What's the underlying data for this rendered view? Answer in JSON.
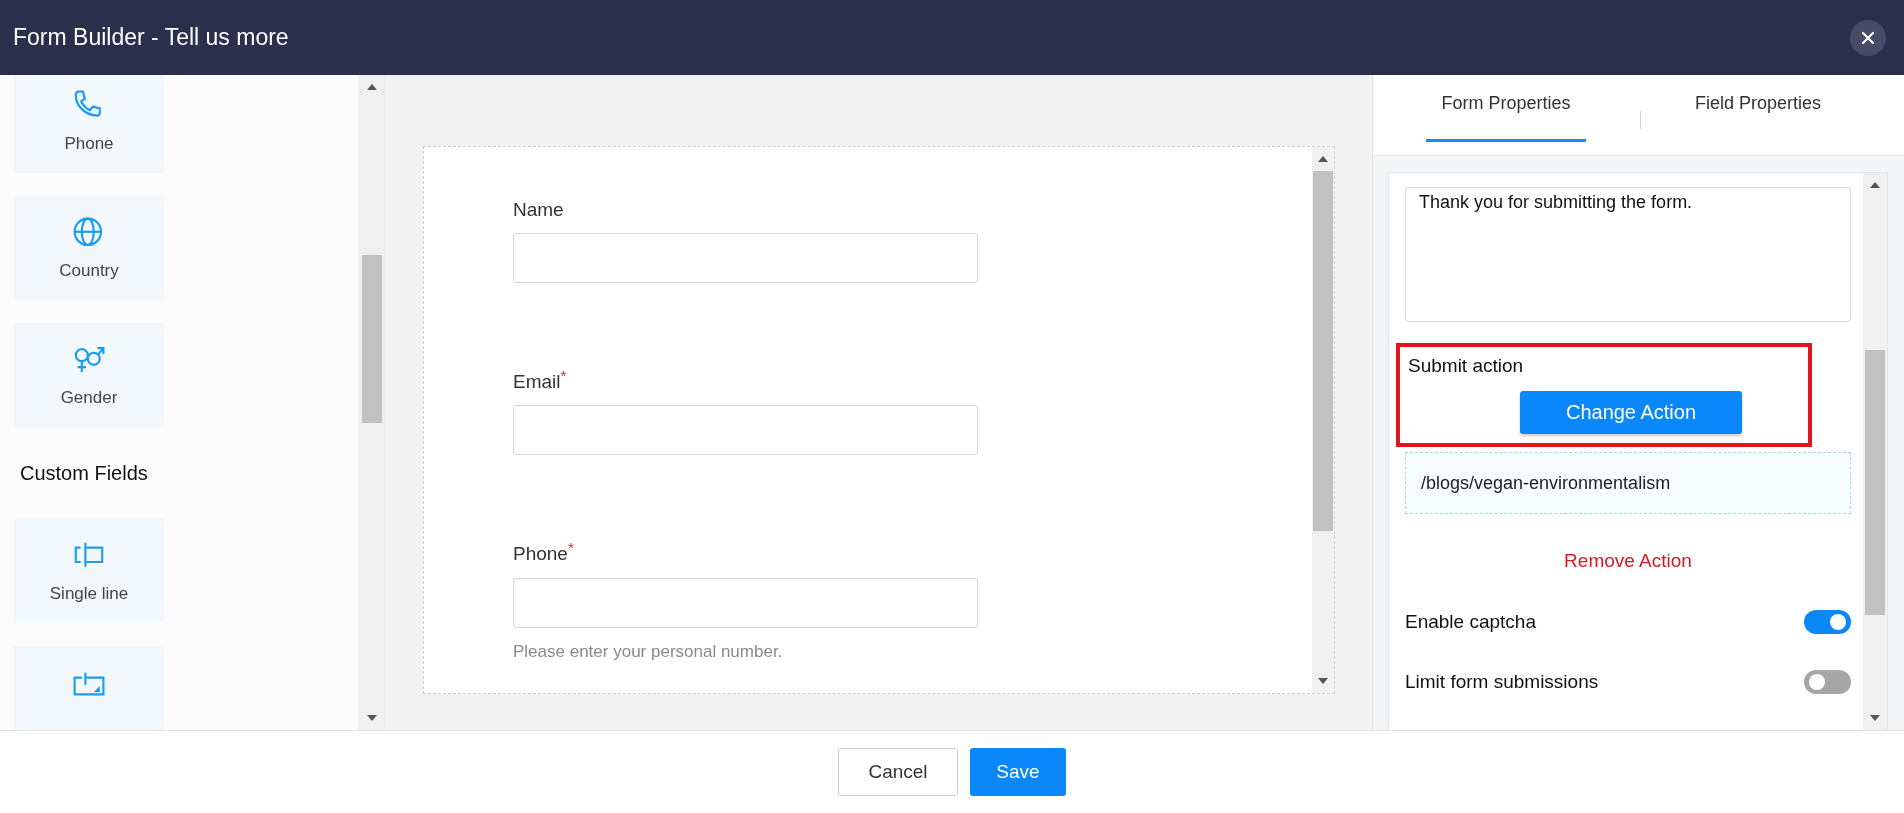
{
  "window": {
    "title": "Form Builder - Tell us more"
  },
  "sidebar": {
    "items": [
      {
        "kind": "phone",
        "label": "Phone"
      },
      {
        "kind": "globe",
        "label": "Country"
      },
      {
        "kind": "gender",
        "label": "Gender"
      },
      {
        "kind": "heading",
        "label": "Custom Fields"
      },
      {
        "kind": "singleline",
        "label": "Single line"
      },
      {
        "kind": "multiline"
      }
    ]
  },
  "form": {
    "fields": [
      {
        "label": "Name"
      },
      {
        "label": "Email$^{*}$"
      },
      {
        "label": "Phone$^{*}$",
        "hint": "Please enter your personal number."
      }
    ]
  },
  "properties": {
    "tabs": [
      {
        "label": "Form Properties",
        "selected": true
      },
      {
        "label": "Field Properties",
        "selected": false
      }
    ],
    "thank_you_message": "Thank you for submitting the form.",
    "submit_action": {
      "label": "Submit action",
      "button": "Change Action",
      "highlighted": true
    },
    "action_url": "/blogs/vegan-environmentalism",
    "remove_action": "Remove Action",
    "settings": [
      {
        "label": "Enable captcha",
        "on": true
      },
      {
        "label": "Limit form submissions",
        "on": false
      }
    ]
  },
  "footer": {
    "buttons": [
      {
        "label": "Cancel",
        "kind": "secondary"
      },
      {
        "label": "Save",
        "kind": "primary"
      }
    ]
  }
}
